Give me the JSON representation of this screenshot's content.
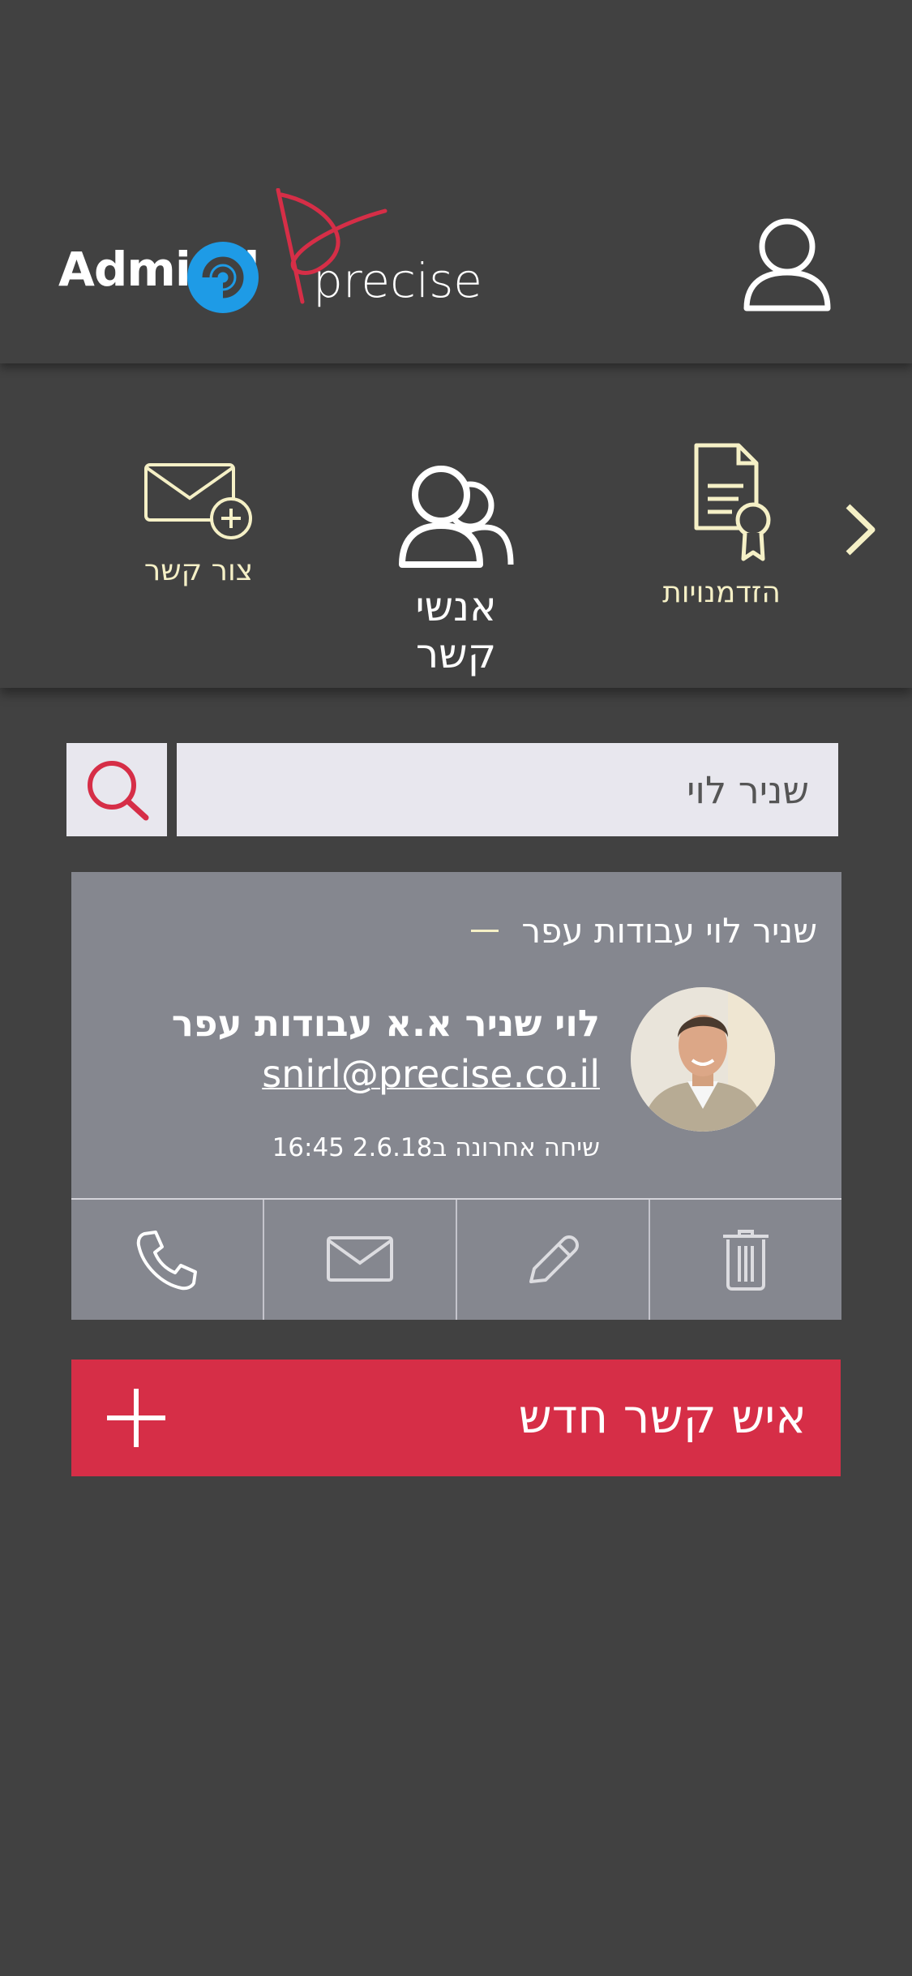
{
  "header": {
    "logo_admiral": "Admiral",
    "logo_precise": "precise",
    "profile_icon": "user-profile-icon"
  },
  "nav": {
    "items": [
      {
        "label": "צור קשר",
        "icon": "envelope-plus-icon",
        "active": false
      },
      {
        "label": "אנשי קשר",
        "icon": "contacts-people-icon",
        "active": true
      },
      {
        "label": "הזדמנויות",
        "icon": "certificate-document-icon",
        "active": false
      }
    ],
    "next_icon": "chevron-right-icon"
  },
  "search": {
    "value": "שניר לוי",
    "icon": "search-icon"
  },
  "card": {
    "group_title": "שניר לוי עבודות עפר",
    "contact_name": "לוי שניר א.א עבודות עפר",
    "email": "snirl@precise.co.il",
    "last_call": "שיחה אחרונה ב2.6.18 16:45",
    "actions": [
      "phone-icon",
      "mail-icon",
      "edit-pencil-icon",
      "trash-icon"
    ]
  },
  "new_contact": {
    "label": "איש קשר חדש",
    "icon": "plus-icon"
  },
  "colors": {
    "background": "#414141",
    "accent_red": "#d62e47",
    "cream": "#f5f0c6",
    "card": "#85878f",
    "search_bg": "#e8e7ee",
    "admiral_blue": "#1e9be6"
  }
}
